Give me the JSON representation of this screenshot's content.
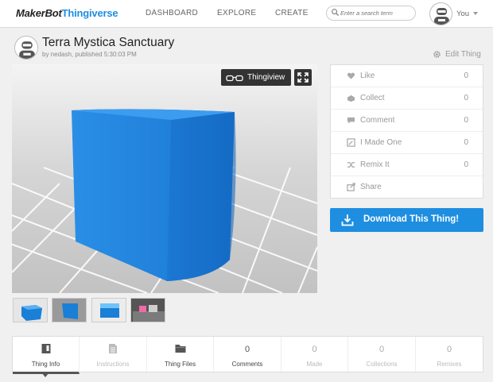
{
  "header": {
    "logo_maker": "MakerBot",
    "logo_thingiverse": "Thingiverse",
    "nav": [
      "DASHBOARD",
      "EXPLORE",
      "CREATE"
    ],
    "search_placeholder": "Enter a search term",
    "user_label": "You"
  },
  "thing": {
    "title": "Terra Mystica Sanctuary",
    "byline": "by nedash, published 5:30:03 PM",
    "edit_label": "Edit Thing"
  },
  "viewer": {
    "thingiview_label": "Thingiview"
  },
  "actions": [
    {
      "label": "Like",
      "count": "0",
      "icon": "heart-icon"
    },
    {
      "label": "Collect",
      "count": "0",
      "icon": "collect-icon"
    },
    {
      "label": "Comment",
      "count": "0",
      "icon": "comment-icon"
    },
    {
      "label": "I Made One",
      "count": "0",
      "icon": "made-icon"
    },
    {
      "label": "Remix It",
      "count": "0",
      "icon": "shuffle-icon"
    },
    {
      "label": "Share",
      "count": "",
      "icon": "share-icon"
    }
  ],
  "download_label": "Download This Thing!",
  "tabs": [
    {
      "label": "Thing Info",
      "icon": "info-icon"
    },
    {
      "label": "Instructions",
      "icon": "document-icon"
    },
    {
      "label": "Thing Files",
      "icon": "folder-icon"
    },
    {
      "label": "Comments",
      "count": "0"
    },
    {
      "label": "Made",
      "count": "0"
    },
    {
      "label": "Collections",
      "count": "0"
    },
    {
      "label": "Remixes",
      "count": "0"
    }
  ],
  "colors": {
    "accent": "#1e8ee0",
    "model": "#1a7fd6"
  }
}
